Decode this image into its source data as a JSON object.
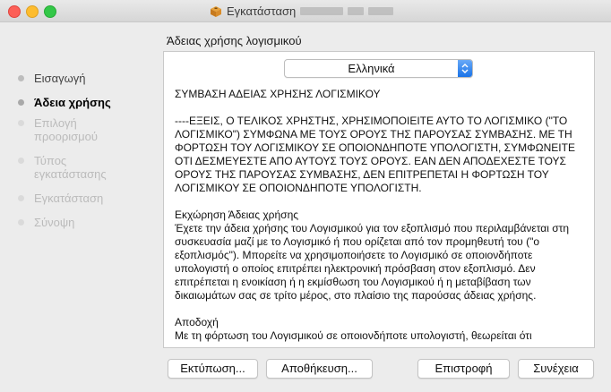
{
  "window": {
    "title": "Εγκατάσταση",
    "colors": {
      "red": "#fc5f57",
      "yellow": "#fdbc2e",
      "green": "#33c748",
      "accent": "#1a73e8"
    }
  },
  "section_heading": "Άδειας χρήσης λογισμικού",
  "sidebar": {
    "steps": [
      {
        "label": "Εισαγωγή",
        "state": "done"
      },
      {
        "label": "Άδεια χρήσης",
        "state": "current"
      },
      {
        "label": "Επιλογή προορισμού",
        "state": "future"
      },
      {
        "label": "Τύπος εγκατάστασης",
        "state": "future"
      },
      {
        "label": "Εγκατάσταση",
        "state": "future"
      },
      {
        "label": "Σύνοψη",
        "state": "future"
      }
    ]
  },
  "language_select": {
    "value": "Ελληνικά"
  },
  "license": {
    "title": "ΣΥΜΒΑΣΗ ΑΔΕΙΑΣ ΧΡΗΣΗΣ ΛΟΓΙΣΜΙΚΟΥ",
    "intro": "----ΕΞΕΙΣ, Ο ΤΕΛΙΚΟΣ ΧΡΗΣΤΗΣ, ΧΡΗΣΙΜΟΠΟΙΕΙΤΕ ΑΥΤΟ ΤΟ ΛΟΓΙΣΜΙΚΟ (\"ΤΟ ΛΟΓΙΣΜΙΚΟ\") ΣΥΜΦΩΝΑ ΜΕ ΤΟΥΣ ΟΡΟΥΣ ΤΗΣ ΠΑΡΟΥΣΑΣ ΣΥΜΒΑΣΗΣ. ΜΕ ΤΗ ΦΟΡΤΩΣΗ ΤΟΥ ΛΟΓΙΣΜΙΚΟΥ ΣΕ ΟΠΟΙΟΝΔΗΠΟΤΕ ΥΠΟΛΟΓΙΣΤΗ, ΣΥΜΦΩΝΕΙΤΕ ΟΤΙ ΔΕΣΜΕΥΕΣΤΕ ΑΠΟ ΑΥΤΟΥΣ ΤΟΥΣ ΟΡΟΥΣ. ΕΑΝ ΔΕΝ ΑΠΟΔΕΧΕΣΤΕ ΤΟΥΣ ΟΡΟΥΣ ΤΗΣ ΠΑΡΟΥΣΑΣ ΣΥΜΒΑΣΗΣ, ΔΕΝ ΕΠΙΤΡΕΠΕΤΑΙ Η ΦΟΡΤΩΣΗ ΤΟΥ ΛΟΓΙΣΜΙΚΟΥ ΣΕ ΟΠΟΙΟΝΔΗΠΟΤΕ ΥΠΟΛΟΓΙΣΤΗ.",
    "grant_heading": "Εκχώρηση Άδειας χρήσης",
    "grant_body": "Έχετε την άδεια χρήσης του Λογισμικού για τον εξοπλισμό που περιλαμβάνεται στη συσκευασία μαζί με το Λογισμικό ή που ορίζεται από τον προμηθευτή του (\"ο εξοπλισμός\"). Μπορείτε να χρησιμοποιήσετε το Λογισμικό σε οποιονδήποτε υπολογιστή ο οποίος επιτρέπει ηλεκτρονική πρόσβαση στον εξοπλισμό. Δεν επιτρέπεται η ενοικίαση ή η εκμίσθωση του Λογισμικού ή η μεταβίβαση των δικαιωμάτων σας σε τρίτο μέρος, στο πλαίσιο της παρούσας άδειας χρήσης.",
    "accept_heading": "Αποδοχή",
    "accept_body": "Με τη φόρτωση του Λογισμικού σε οποιονδήποτε υπολογιστή, θεωρείται ότι"
  },
  "buttons": {
    "print": "Εκτύπωση...",
    "save": "Αποθήκευση...",
    "back": "Επιστροφή",
    "continue": "Συνέχεια"
  }
}
